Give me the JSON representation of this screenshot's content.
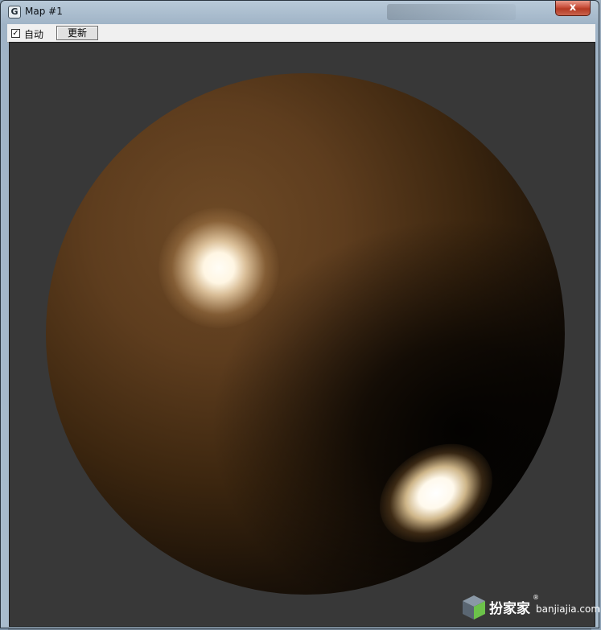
{
  "window": {
    "title": "Map #1",
    "app_icon_glyph": "G",
    "close_label": "x"
  },
  "toolbar": {
    "auto_checked": true,
    "auto_check_glyph": "✓",
    "auto_label": "自动",
    "update_label": "更新"
  },
  "viewport": {
    "background_color": "#383838",
    "sphere_base_color": "#6e4a26"
  },
  "watermark": {
    "brand": "扮家家",
    "registered": "®",
    "url": "banjiajia.com"
  }
}
